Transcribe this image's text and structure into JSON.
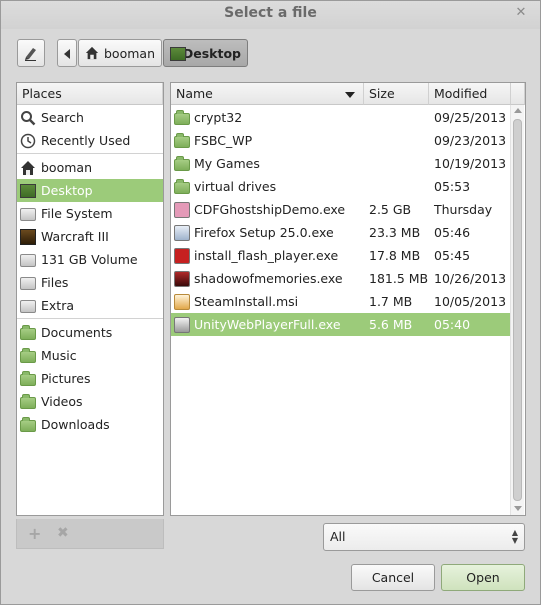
{
  "window": {
    "title": "Select a file"
  },
  "pathbar": {
    "crumbs": [
      {
        "label": "booman",
        "icon": "home-icon"
      },
      {
        "label": "Desktop",
        "icon": "desktop-icon"
      }
    ]
  },
  "places": {
    "header": "Places",
    "items": [
      {
        "label": "Search",
        "icon": "search-icon"
      },
      {
        "label": "Recently Used",
        "icon": "clock-icon"
      },
      {
        "label": "booman",
        "icon": "home-icon"
      },
      {
        "label": "Desktop",
        "icon": "desktop-icon",
        "selected": true
      },
      {
        "label": "File System",
        "icon": "drive-icon"
      },
      {
        "label": "Warcraft III",
        "icon": "game-disc-icon"
      },
      {
        "label": "131 GB Volume",
        "icon": "drive-icon"
      },
      {
        "label": "Files",
        "icon": "drive-icon"
      },
      {
        "label": "Extra",
        "icon": "drive-icon"
      },
      {
        "label": "Documents",
        "icon": "folder-icon"
      },
      {
        "label": "Music",
        "icon": "music-folder-icon"
      },
      {
        "label": "Pictures",
        "icon": "pictures-folder-icon"
      },
      {
        "label": "Videos",
        "icon": "videos-folder-icon"
      },
      {
        "label": "Downloads",
        "icon": "downloads-folder-icon"
      }
    ]
  },
  "files": {
    "columns": {
      "name": "Name",
      "size": "Size",
      "modified": "Modified"
    },
    "rows": [
      {
        "name": "crypt32",
        "size": "",
        "modified": "09/25/2013",
        "icon": "folder-icon"
      },
      {
        "name": "FSBC_WP",
        "size": "",
        "modified": "09/23/2013",
        "icon": "folder-icon"
      },
      {
        "name": "My Games",
        "size": "",
        "modified": "10/19/2013",
        "icon": "folder-icon"
      },
      {
        "name": "virtual drives",
        "size": "",
        "modified": "05:53",
        "icon": "folder-icon"
      },
      {
        "name": "CDFGhostshipDemo.exe",
        "size": "2.5 GB",
        "modified": "Thursday",
        "icon": "exe-icon"
      },
      {
        "name": "Firefox Setup 25.0.exe",
        "size": "23.3 MB",
        "modified": "05:46",
        "icon": "installer-icon"
      },
      {
        "name": "install_flash_player.exe",
        "size": "17.8 MB",
        "modified": "05:45",
        "icon": "flash-icon"
      },
      {
        "name": "shadowofmemories.exe",
        "size": "181.5 MB",
        "modified": "10/26/2013",
        "icon": "exe-icon"
      },
      {
        "name": "SteamInstall.msi",
        "size": "1.7 MB",
        "modified": "10/05/2013",
        "icon": "msi-icon"
      },
      {
        "name": "UnityWebPlayerFull.exe",
        "size": "5.6 MB",
        "modified": "05:40",
        "icon": "unity-icon",
        "selected": true
      }
    ]
  },
  "filter": {
    "selected": "All"
  },
  "buttons": {
    "cancel": "Cancel",
    "open": "Open"
  },
  "colors": {
    "selection": "#9ccb7a",
    "folder": "#8ab96a"
  }
}
